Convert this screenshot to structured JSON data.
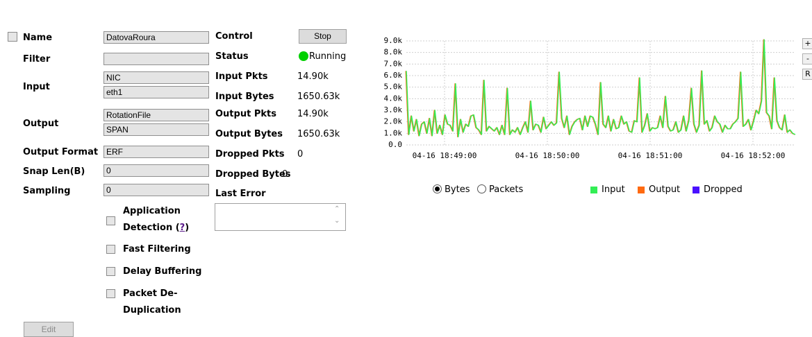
{
  "config": {
    "name": {
      "label": "Name",
      "value": "DatovaRoura"
    },
    "filter": {
      "label": "Filter",
      "value": ""
    },
    "input": {
      "label": "Input",
      "values": [
        "NIC",
        "eth1"
      ]
    },
    "output": {
      "label": "Output",
      "values": [
        "RotationFile",
        "SPAN"
      ]
    },
    "output_format": {
      "label": "Output Format",
      "value": "ERF"
    },
    "snap_len": {
      "label": "Snap Len(B)",
      "value": "0"
    },
    "sampling": {
      "label": "Sampling",
      "value": "0"
    },
    "options": {
      "app_detection": {
        "line1": "Application",
        "line2": "Detection (",
        "help": "?",
        "close": ")"
      },
      "fast_filtering": "Fast Filtering",
      "delay_buffering": "Delay Buffering",
      "packet_dedup": {
        "line1": "Packet De-",
        "line2": "Duplication"
      }
    },
    "edit_button": "Edit"
  },
  "status_panel": {
    "control_label": "Control",
    "stop_button": "Stop",
    "status_label": "Status",
    "status_value": "Running",
    "status_color": "#00d000",
    "input_pkts_label": "Input Pkts",
    "input_pkts": "14.90k",
    "input_bytes_label": "Input Bytes",
    "input_bytes": "1650.63k",
    "output_pkts_label": "Output Pkts",
    "output_pkts": "14.90k",
    "output_bytes_label": "Output Bytes",
    "output_bytes": "1650.63k",
    "dropped_pkts_label": "Dropped Pkts",
    "dropped_pkts": "0",
    "dropped_bytes_label": "Dropped Bytes",
    "dropped_bytes": "0",
    "last_error_label": "Last Error",
    "last_error_value": ""
  },
  "chart_controls": {
    "radio_bytes": "Bytes",
    "radio_packets": "Packets",
    "selected": "Bytes",
    "zoom_in": "+",
    "zoom_out": "-",
    "reset": "R"
  },
  "chart_data": {
    "type": "line",
    "ylim": [
      0,
      9000
    ],
    "y_ticks": [
      "0.0",
      "1.0k",
      "2.0k",
      "3.0k",
      "4.0k",
      "5.0k",
      "6.0k",
      "7.0k",
      "8.0k",
      "9.0k"
    ],
    "x_ticks": [
      "04-16 18:49:00",
      "04-16 18:50:00",
      "04-16 18:51:00",
      "04-16 18:52:00"
    ],
    "grid": true,
    "legend_position": "bottom",
    "series": [
      {
        "name": "Input",
        "color": "#33ee55",
        "values": [
          6400,
          900,
          2500,
          1200,
          2200,
          800,
          1800,
          2000,
          1000,
          2300,
          800,
          3000,
          1000,
          1700,
          900,
          2600,
          1800,
          1700,
          1200,
          5300,
          700,
          2200,
          1100,
          1800,
          1600,
          2500,
          2600,
          1500,
          1300,
          900,
          5600,
          1200,
          1600,
          1400,
          1200,
          1500,
          900,
          1700,
          900,
          4900,
          900,
          1300,
          1100,
          1500,
          900,
          1500,
          2000,
          1100,
          3800,
          1300,
          1800,
          1700,
          1100,
          2400,
          1400,
          1700,
          2000,
          1700,
          1900,
          6300,
          2300,
          1500,
          2500,
          900,
          1600,
          2000,
          2200,
          2300,
          1300,
          2500,
          1600,
          2500,
          2400,
          1800,
          900,
          5400,
          1800,
          1500,
          2500,
          1200,
          2200,
          1400,
          1500,
          2500,
          1800,
          2000,
          1200,
          1100,
          2100,
          2000,
          5800,
          1100,
          1700,
          2700,
          1200,
          1500,
          1400,
          1500,
          2500,
          1500,
          4200,
          1600,
          1200,
          1300,
          2000,
          1100,
          1300,
          2500,
          1200,
          2100,
          4900,
          1800,
          1100,
          1700,
          6400,
          1800,
          2100,
          1200,
          1500,
          2500,
          2000,
          1800,
          1100,
          1700,
          1400,
          1400,
          1800,
          2000,
          2300,
          6300,
          1600,
          1800,
          2200,
          1300,
          2100,
          3000,
          2700,
          3800,
          9100,
          2800,
          2500,
          1400,
          5800,
          2100,
          1500,
          1300,
          2600,
          1100,
          1300,
          1000,
          900
        ]
      },
      {
        "name": "Output",
        "color": "#ff6a10",
        "values": [
          6400,
          900,
          2500,
          1200,
          2200,
          800,
          1800,
          2000,
          1000,
          2300,
          800,
          3000,
          1000,
          1700,
          900,
          2600,
          1800,
          1700,
          1200,
          5300,
          700,
          2200,
          1100,
          1800,
          1600,
          2500,
          2600,
          1500,
          1300,
          900,
          5600,
          1200,
          1600,
          1400,
          1200,
          1500,
          900,
          1700,
          900,
          4900,
          900,
          1300,
          1100,
          1500,
          900,
          1500,
          2000,
          1100,
          3800,
          1300,
          1800,
          1700,
          1100,
          2400,
          1400,
          1700,
          2000,
          1700,
          1900,
          6300,
          2300,
          1500,
          2500,
          900,
          1600,
          2000,
          2200,
          2300,
          1300,
          2500,
          1600,
          2500,
          2400,
          1800,
          900,
          5400,
          1800,
          1500,
          2500,
          1200,
          2200,
          1400,
          1500,
          2500,
          1800,
          2000,
          1200,
          1100,
          2100,
          2000,
          5800,
          1100,
          1700,
          2700,
          1200,
          1500,
          1400,
          1500,
          2500,
          1500,
          4200,
          1600,
          1200,
          1300,
          2000,
          1100,
          1300,
          2500,
          1200,
          2100,
          4900,
          1800,
          1100,
          1700,
          6400,
          1800,
          2100,
          1200,
          1500,
          2500,
          2000,
          1800,
          1100,
          1700,
          1400,
          1400,
          1800,
          2000,
          2300,
          6300,
          1600,
          1800,
          2200,
          1300,
          2100,
          3000,
          2700,
          3800,
          9100,
          2800,
          2500,
          1400,
          5800,
          2100,
          1500,
          1300,
          2600,
          1100,
          1300,
          1000,
          900
        ]
      },
      {
        "name": "Dropped",
        "color": "#4a10ff",
        "values": []
      }
    ]
  }
}
